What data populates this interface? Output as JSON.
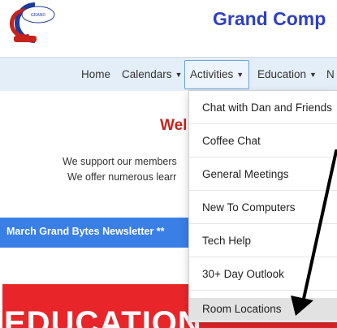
{
  "header": {
    "logo_text": "GRAND COMPUTERS CLUB",
    "title": "Grand Comp"
  },
  "nav": {
    "items": [
      {
        "label": "Home",
        "caret": ""
      },
      {
        "label": "Calendars",
        "caret": "▼"
      },
      {
        "label": "Activities",
        "caret": "▼"
      },
      {
        "label": "Education",
        "caret": "▼"
      },
      {
        "label": "N",
        "caret": ""
      }
    ]
  },
  "main": {
    "welcome": "Wel",
    "intro_line1": "We support our members",
    "intro_line2": "We offer numerous learr",
    "ticker": "March Grand Bytes Newsletter **",
    "banner": "EDUCATION"
  },
  "dropdown": {
    "items": [
      "Chat with Dan and Friends",
      "Coffee Chat",
      "General Meetings",
      "New To Computers",
      "Tech Help",
      "30+ Day Outlook",
      "Room Locations"
    ],
    "highlighted": "Room Locations"
  },
  "annotation": {
    "arrow_color": "#000000"
  }
}
